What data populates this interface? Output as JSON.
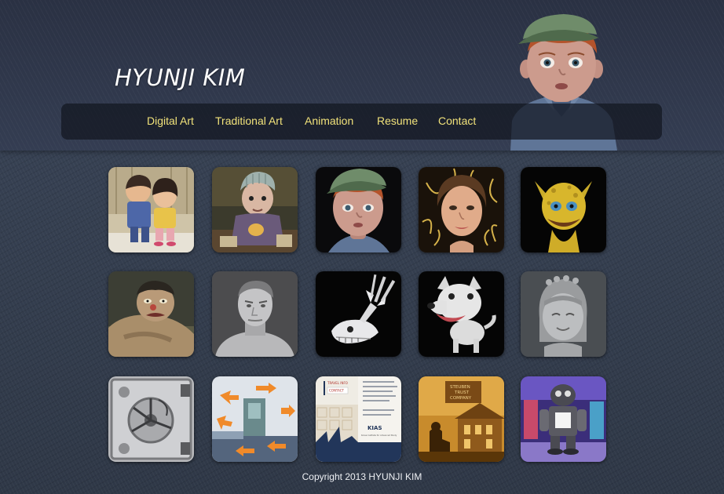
{
  "site": {
    "title": "HYUNJI KIM"
  },
  "nav": {
    "items": [
      {
        "label": "Digital Art"
      },
      {
        "label": "Traditional Art"
      },
      {
        "label": "Animation"
      },
      {
        "label": "Resume"
      },
      {
        "label": "Contact"
      }
    ]
  },
  "gallery": {
    "rows": [
      [
        {
          "subject": "two cartoon kids sitting"
        },
        {
          "subject": "old woman with knit cap"
        },
        {
          "subject": "boy with green cap"
        },
        {
          "subject": "woman with golden sunburst"
        },
        {
          "subject": "yellow alien creature"
        }
      ],
      [
        {
          "subject": "crouching zombie man"
        },
        {
          "subject": "grey sculpted man bust"
        },
        {
          "subject": "white dinosaur skeleton"
        },
        {
          "subject": "white cartoon dog"
        },
        {
          "subject": "grey sculpted girl face"
        }
      ],
      [
        {
          "subject": "vault door with dial"
        },
        {
          "subject": "room layout with orange arrows"
        },
        {
          "subject": "KIAS brochure design",
          "texts": [
            "TRAVEL INFO",
            "CONTACT",
            "KIAS",
            "Korea Institute for Advanced Study"
          ]
        },
        {
          "subject": "Steuben Trust Company illustration",
          "texts": [
            "STEUBEN",
            "TRUST",
            "COMPANY"
          ]
        },
        {
          "subject": "robot in toy store"
        }
      ]
    ]
  },
  "footer": {
    "text": "Copyright 2013 HYUNJI KIM"
  }
}
